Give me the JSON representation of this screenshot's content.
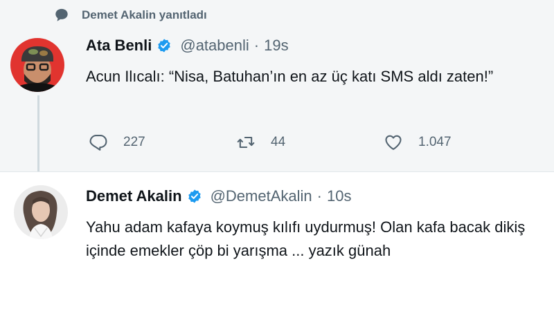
{
  "reply_context": {
    "icon": "speech-bubble-icon",
    "label": "Demet Akalin yanıtladı"
  },
  "tweets": [
    {
      "display_name": "Ata Benli",
      "verified": true,
      "handle": "@atabenli",
      "separator": "·",
      "time": "19s",
      "text": "Acun Ilıcalı: “Nisa, Batuhan’ın en az üç katı SMS aldı zaten!”",
      "actions": {
        "reply_count": "227",
        "retweet_count": "44",
        "like_count": "1.047"
      }
    },
    {
      "display_name": "Demet Akalin",
      "verified": true,
      "handle": "@DemetAkalin",
      "separator": "·",
      "time": "10s",
      "text": "Yahu adam kafaya koymuş kılıfı uydurmuş! Olan kafa bacak dikiş içinde emekler çöp bi yarışma ... yazık günah"
    }
  ],
  "colors": {
    "verified_blue": "#1d9bf0",
    "secondary_text": "#536471",
    "primary_text": "#0f1419",
    "top_background": "#f4f6f7"
  }
}
